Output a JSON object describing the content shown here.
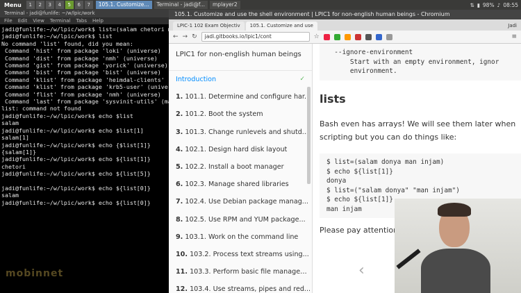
{
  "panel": {
    "menu_label": "Menu",
    "workspaces": [
      "1",
      "2",
      "3",
      "4",
      "5",
      "6",
      "7"
    ],
    "active_workspace": "5",
    "tasks": [
      {
        "label": "105.1. Customize...",
        "active": true
      },
      {
        "label": "Terminal - jadi@f...",
        "active": false
      },
      {
        "label": "mplayer2",
        "active": false
      }
    ],
    "battery": "98%",
    "time": "08:55"
  },
  "terminal": {
    "title": "Terminal - jadi@funlife: ~/w/lpic/work",
    "menu": [
      "File",
      "Edit",
      "View",
      "Terminal",
      "Tabs",
      "Help"
    ],
    "lines": [
      "jadi@funlife:~/w/lpic/work$ list=(salam chetori m",
      "jadi@funlife:~/w/lpic/work$ list",
      "No command 'list' found, did you mean:",
      " Command 'hist' from package 'loki' (universe)",
      " Command 'dist' from package 'nmh' (universe)",
      " Command 'gist' from package 'yorick' (universe)",
      " Command 'bist' from package 'bist' (universe)",
      " Command 'klist' from package 'heimdal-clients' (",
      " Command 'klist' from package 'krb5-user' (univer",
      " Command 'flist' from package 'nmh' (universe)",
      " Command 'last' from package 'sysvinit-utils' (ma",
      "list: command not found",
      "jadi@funlife:~/w/lpic/work$ echo $list",
      "salam",
      "jadi@funlife:~/w/lpic/work$ echo $list[1]",
      "salam[1]",
      "jadi@funlife:~/w/lpic/work$ echo {$list[1]}",
      "{salam[1]}",
      "jadi@funlife:~/w/lpic/work$ echo ${list[1]}",
      "chetori",
      "jadi@funlife:~/w/lpic/work$ echo ${list[5]}",
      "",
      "jadi@funlife:~/w/lpic/work$ echo ${list[0]}",
      "salam",
      "jadi@funlife:~/w/lpic/work$ echo ${list[0]}"
    ],
    "watermark": "mobinnet"
  },
  "browser": {
    "window_title": "105.1. Customize and use the shell environment | LPIC1 for non-english human beings - Chromium",
    "tabs": [
      {
        "label": "LPIC-1 102 Exam Objectiv",
        "active": false
      },
      {
        "label": "105.1. Customize and use",
        "active": true
      }
    ],
    "user": "Jadi",
    "url": "jadi.gitbooks.io/lpic1/cont"
  },
  "sidebar": {
    "title": "LPIC1 for non-english human beings",
    "intro": "Introduction",
    "items": [
      {
        "num": "1.",
        "label": "101.1. Determine and configure har..."
      },
      {
        "num": "2.",
        "label": "101.2. Boot the system"
      },
      {
        "num": "3.",
        "label": "101.3. Change runlevels and shutd..."
      },
      {
        "num": "4.",
        "label": "102.1. Design hard disk layout"
      },
      {
        "num": "5.",
        "label": "102.2. Install a boot manager"
      },
      {
        "num": "6.",
        "label": "102.3. Manage shared libraries"
      },
      {
        "num": "7.",
        "label": "102.4. Use Debian package manag..."
      },
      {
        "num": "8.",
        "label": "102.5. Use RPM and YUM package..."
      },
      {
        "num": "9.",
        "label": "103.1. Work on the command line"
      },
      {
        "num": "10.",
        "label": "103.2. Process text streams using..."
      },
      {
        "num": "11.",
        "label": "103.3. Perform basic file managem..."
      },
      {
        "num": "12.",
        "label": "103.4. Use streams, pipes and red..."
      }
    ]
  },
  "content": {
    "top_code": "  --ignore-environment\n      Start with an empty environment, ignor\n      environment.",
    "heading": "lists",
    "paragraph": "Bash even has arrays! We will see them later when scripting but you can do things like:",
    "code": "$ list=(salam donya man injam)\n$ echo ${list[1]}\ndonya\n$ list=(\"salam donya\" \"man injam\")\n$ echo ${list[1]}\nman injam",
    "paragraph2": "Please pay attention t"
  }
}
